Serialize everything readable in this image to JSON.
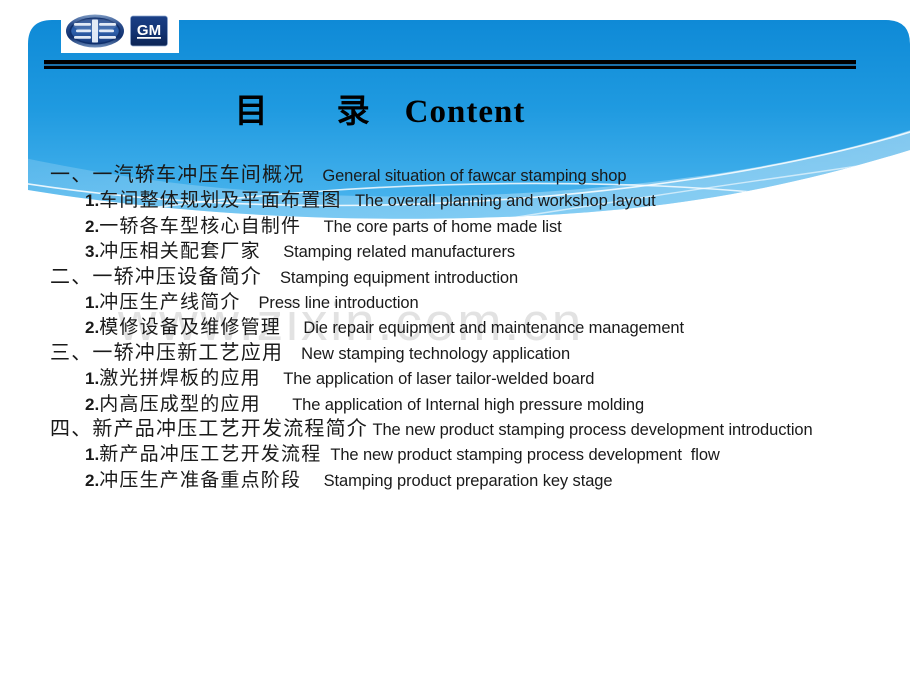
{
  "slide": {
    "title": "目　　录　Content",
    "watermark": "www.zixin.com.cn",
    "colors": {
      "banner_top": "#0d8ddb",
      "banner_bottom": "#4cb3ef",
      "rule_black": "#000000",
      "rule_blue": "#1b6fa8",
      "text": "#1a1a1a",
      "watermark": "#e2e2e2"
    }
  },
  "logos": [
    {
      "name": "faw-logo",
      "alt": "FAW"
    },
    {
      "name": "gm-logo",
      "alt": "GM"
    }
  ],
  "toc": [
    {
      "level": 1,
      "marker": "一、",
      "zh": "一汽轿车冲压车间概况",
      "gap": "    ",
      "en": "General situation of fawcar stamping shop"
    },
    {
      "level": 2,
      "num": "1.",
      "zh": "车间整体规划及平面布置图",
      "gap": "   ",
      "en": "The overall planning and workshop layout"
    },
    {
      "level": 2,
      "num": "2.",
      "zh": "一轿各车型核心自制件",
      "gap": "     ",
      "en": "The core parts of home made list"
    },
    {
      "level": 2,
      "num": "3.",
      "zh": "冲压相关配套厂家",
      "gap": "     ",
      "en": "Stamping related manufacturers"
    },
    {
      "level": 1,
      "marker": "二、",
      "zh": "一轿冲压设备简介",
      "gap": "    ",
      "en": "Stamping equipment introduction"
    },
    {
      "level": 2,
      "num": "1.",
      "zh": "冲压生产线简介",
      "gap": "    ",
      "en": "Press line introduction"
    },
    {
      "level": 2,
      "num": "2.",
      "zh": "模修设备及维修管理",
      "gap": "     ",
      "en": "Die repair equipment and maintenance management"
    },
    {
      "level": 1,
      "marker": "三、",
      "zh": "一轿冲压新工艺应用",
      "gap": "    ",
      "en": "New stamping technology application"
    },
    {
      "level": 2,
      "num": "1.",
      "zh": "激光拼焊板的应用",
      "gap": "     ",
      "en": "The application of laser tailor-welded board"
    },
    {
      "level": 2,
      "num": "2.",
      "zh": "内高压成型的应用",
      "gap": "       ",
      "en": "The application of Internal high pressure molding"
    },
    {
      "level": 1,
      "marker": "四、",
      "zh": "新产品冲压工艺开发流程简介",
      "gap": " ",
      "en": "The new product stamping process development introduction"
    },
    {
      "level": 2,
      "num": "1.",
      "zh": "新产品冲压工艺开发流程",
      "gap": "  ",
      "en": "The new product stamping process development  flow"
    },
    {
      "level": 2,
      "num": "2.",
      "zh": "冲压生产准备重点阶段",
      "gap": "     ",
      "en": "Stamping product preparation key stage"
    }
  ]
}
